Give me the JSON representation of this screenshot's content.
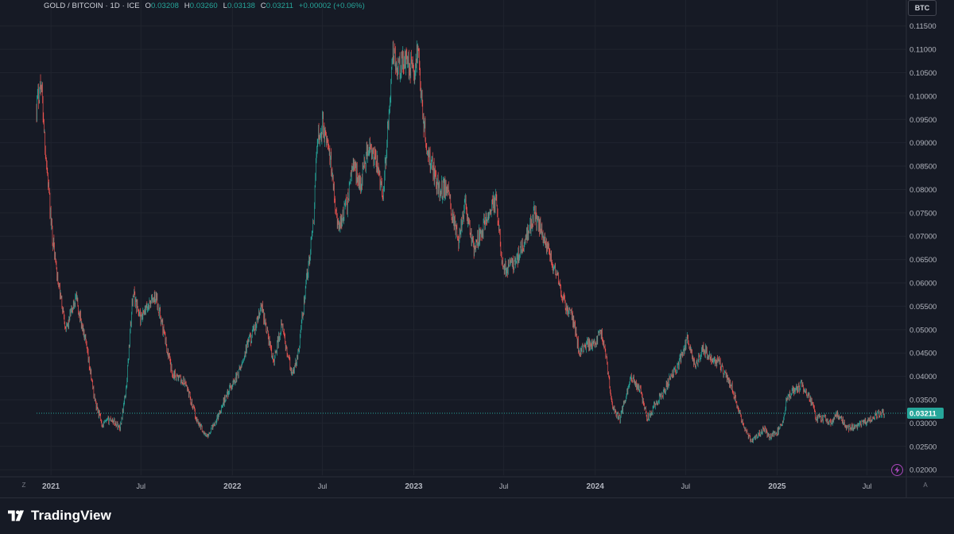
{
  "header": {
    "symbol": "GOLD / BITCOIN · 1D · ICE",
    "open_label": "O",
    "open_value": "0.03208",
    "high_label": "H",
    "high_value": "0.03260",
    "low_label": "L",
    "low_value": "0.03138",
    "close_label": "C",
    "close_value": "0.03211",
    "change": "+0.00002 (+0.06%)",
    "currency": "BTC"
  },
  "price_badge": "0.03211",
  "axis_markers": {
    "left": "Z",
    "right": "A"
  },
  "footer": {
    "brand": "TradingView"
  },
  "colors": {
    "up": "#26a69a",
    "down": "#ef5350",
    "background": "#161a25",
    "grid": "#20242f",
    "axis_text": "#b2b5be",
    "badge": "#26a69a"
  },
  "chart_data": {
    "type": "candlestick",
    "timeframe": "1D",
    "ylim": [
      0.0185,
      0.1175
    ],
    "y_ticks": [
      "0.11500",
      "0.11000",
      "0.10500",
      "0.10000",
      "0.09500",
      "0.09000",
      "0.08500",
      "0.08000",
      "0.07500",
      "0.07000",
      "0.06500",
      "0.06000",
      "0.05500",
      "0.05000",
      "0.04500",
      "0.04000",
      "0.03500",
      "0.03000",
      "0.02500",
      "0.02000"
    ],
    "x_ticks": [
      "2021",
      "Jul",
      "2022",
      "Jul",
      "2023",
      "Jul",
      "2024",
      "Jul",
      "2025",
      "Jul"
    ],
    "x_range": [
      "2020-12-03",
      "2025-09-18"
    ],
    "last_price": 0.03211,
    "series": [
      {
        "name": "GOLD / BITCOIN",
        "dates": [
          "2020-12-03",
          "2020-12-12",
          "2020-12-20",
          "2021-01-01",
          "2021-01-15",
          "2021-02-01",
          "2021-02-20",
          "2021-03-10",
          "2021-04-01",
          "2021-04-15",
          "2021-05-01",
          "2021-05-20",
          "2021-06-01",
          "2021-06-15",
          "2021-07-01",
          "2021-07-20",
          "2021-08-01",
          "2021-09-01",
          "2021-10-01",
          "2021-10-20",
          "2021-11-10",
          "2021-12-01",
          "2021-12-20",
          "2022-01-15",
          "2022-02-01",
          "2022-02-15",
          "2022-03-01",
          "2022-03-25",
          "2022-04-10",
          "2022-05-01",
          "2022-05-12",
          "2022-06-01",
          "2022-06-13",
          "2022-06-20",
          "2022-07-01",
          "2022-07-20",
          "2022-08-01",
          "2022-08-20",
          "2022-09-01",
          "2022-09-15",
          "2022-10-01",
          "2022-10-20",
          "2022-11-01",
          "2022-11-09",
          "2022-11-21",
          "2022-12-01",
          "2022-12-15",
          "2023-01-01",
          "2023-01-10",
          "2023-01-20",
          "2023-02-01",
          "2023-02-20",
          "2023-03-10",
          "2023-03-20",
          "2023-04-01",
          "2023-04-15",
          "2023-05-01",
          "2023-05-20",
          "2023-06-01",
          "2023-06-15",
          "2023-06-25",
          "2023-07-01",
          "2023-07-20",
          "2023-08-01",
          "2023-08-17",
          "2023-09-01",
          "2023-09-11",
          "2023-10-01",
          "2023-10-20",
          "2023-11-01",
          "2023-11-15",
          "2023-12-01",
          "2023-12-15",
          "2024-01-01",
          "2024-01-11",
          "2024-01-22",
          "2024-02-05",
          "2024-02-20",
          "2024-03-01",
          "2024-03-14",
          "2024-04-01",
          "2024-04-15",
          "2024-05-01",
          "2024-05-20",
          "2024-06-01",
          "2024-06-15",
          "2024-07-05",
          "2024-07-20",
          "2024-08-05",
          "2024-08-20",
          "2024-09-06",
          "2024-09-20",
          "2024-10-01",
          "2024-10-20",
          "2024-11-01",
          "2024-11-12",
          "2024-11-22",
          "2024-12-05",
          "2024-12-17",
          "2025-01-01",
          "2025-01-13",
          "2025-01-20",
          "2025-02-03",
          "2025-02-20",
          "2025-03-10",
          "2025-03-20",
          "2025-04-08",
          "2025-04-20",
          "2025-05-01",
          "2025-05-22",
          "2025-06-05",
          "2025-06-22",
          "2025-07-10",
          "2025-07-22",
          "2025-08-05",
          "2025-08-20",
          "2025-09-01",
          "2025-09-18"
        ],
        "values": [
          0.098,
          0.1035,
          0.09,
          0.073,
          0.06,
          0.05,
          0.057,
          0.048,
          0.034,
          0.0295,
          0.031,
          0.029,
          0.037,
          0.058,
          0.052,
          0.056,
          0.057,
          0.041,
          0.038,
          0.031,
          0.027,
          0.031,
          0.036,
          0.041,
          0.047,
          0.05,
          0.055,
          0.043,
          0.051,
          0.04,
          0.044,
          0.062,
          0.072,
          0.09,
          0.094,
          0.085,
          0.072,
          0.077,
          0.086,
          0.081,
          0.089,
          0.085,
          0.079,
          0.092,
          0.11,
          0.106,
          0.108,
          0.105,
          0.11,
          0.094,
          0.087,
          0.08,
          0.08,
          0.074,
          0.069,
          0.077,
          0.067,
          0.072,
          0.075,
          0.078,
          0.067,
          0.063,
          0.064,
          0.066,
          0.07,
          0.075,
          0.072,
          0.066,
          0.06,
          0.055,
          0.053,
          0.045,
          0.047,
          0.047,
          0.05,
          0.045,
          0.033,
          0.031,
          0.035,
          0.04,
          0.037,
          0.031,
          0.034,
          0.037,
          0.04,
          0.042,
          0.048,
          0.042,
          0.046,
          0.044,
          0.043,
          0.04,
          0.038,
          0.031,
          0.028,
          0.026,
          0.027,
          0.029,
          0.027,
          0.028,
          0.03,
          0.035,
          0.037,
          0.038,
          0.035,
          0.031,
          0.031,
          0.03,
          0.032,
          0.029,
          0.029,
          0.03,
          0.031,
          0.032,
          0.032
        ]
      }
    ]
  }
}
